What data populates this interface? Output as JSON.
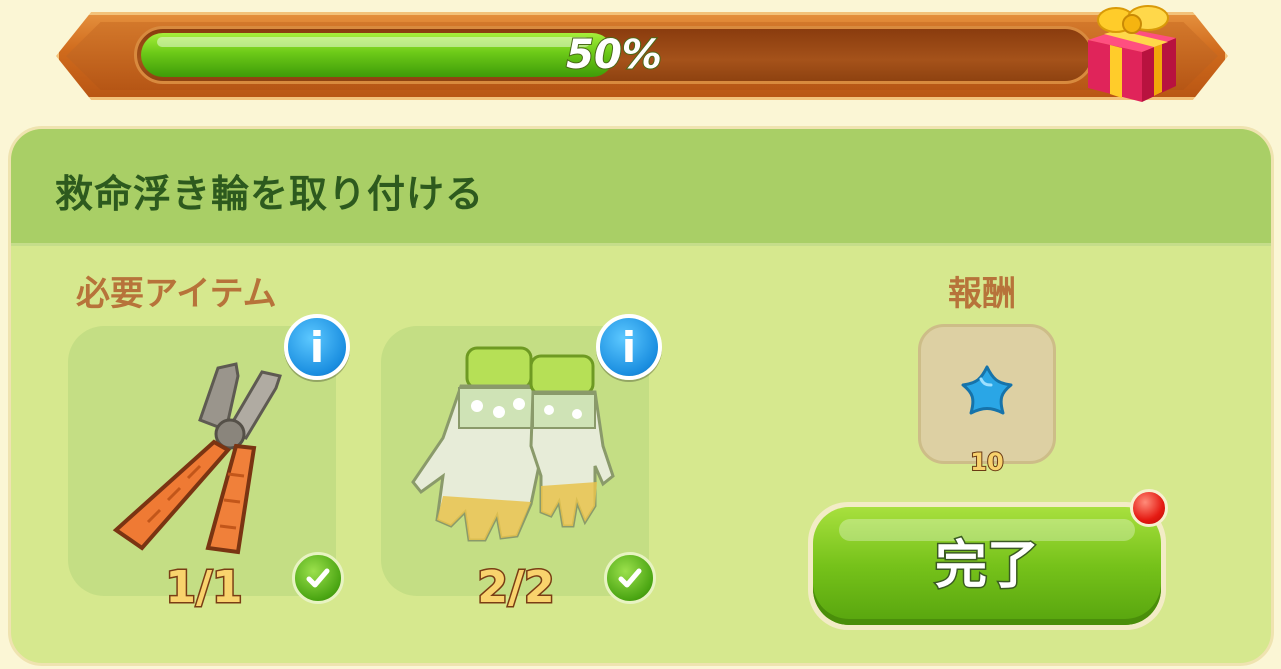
{
  "progress": {
    "label": "50%",
    "fraction": 0.5
  },
  "gift": {
    "icon": "gift-box-icon"
  },
  "task": {
    "title": "救命浮き輪を取り付ける"
  },
  "required": {
    "label": "必要アイテム",
    "items": [
      {
        "name": "pliers",
        "icon": "pliers-icon",
        "count": "1/1",
        "complete": true
      },
      {
        "name": "gloves",
        "icon": "gloves-icon",
        "count": "2/2",
        "complete": true
      }
    ]
  },
  "reward": {
    "label": "報酬",
    "icon": "blue-star-icon",
    "value": "10"
  },
  "complete_button": {
    "label": "完了",
    "has_notification": true
  },
  "colors": {
    "progress_fill": "#6cc918",
    "panel": "#d6e88e",
    "header": "#a9cf66",
    "title": "#2d5a1e",
    "section_label": "#b7733a",
    "info": "#1a8ee0",
    "button": "#76c21a",
    "notification": "#e51a12"
  }
}
